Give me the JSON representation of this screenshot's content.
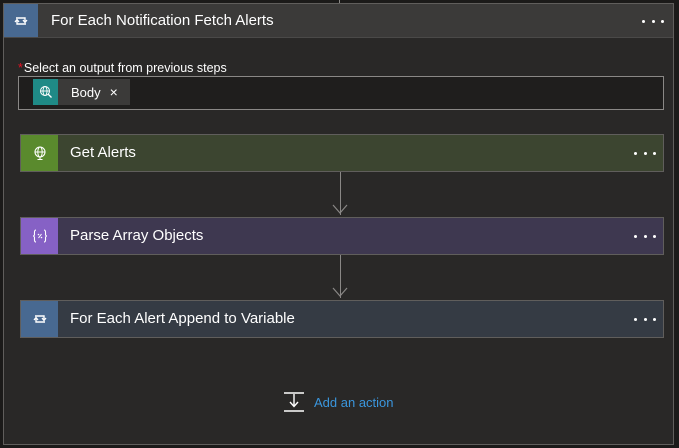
{
  "outer_scope": {
    "title": "For Each Notification Fetch Alerts",
    "icon": "loop-icon",
    "accent": "#486991"
  },
  "select_output": {
    "label": "Select an output from previous steps",
    "required_marker": "*",
    "token": {
      "label": "Body",
      "remove": "×",
      "icon": "http-globe-icon",
      "color": "#1f8a86"
    }
  },
  "steps": [
    {
      "title": "Get Alerts",
      "icon": "globe-icon",
      "color": "#5a8a2d"
    },
    {
      "title": "Parse Array Objects",
      "icon": "json-braces-icon",
      "color": "#8661c5"
    },
    {
      "title": "For Each Alert Append to Variable",
      "icon": "loop-icon",
      "color": "#486991"
    }
  ],
  "add_action": {
    "label": "Add an action",
    "icon": "insert-action-icon"
  }
}
